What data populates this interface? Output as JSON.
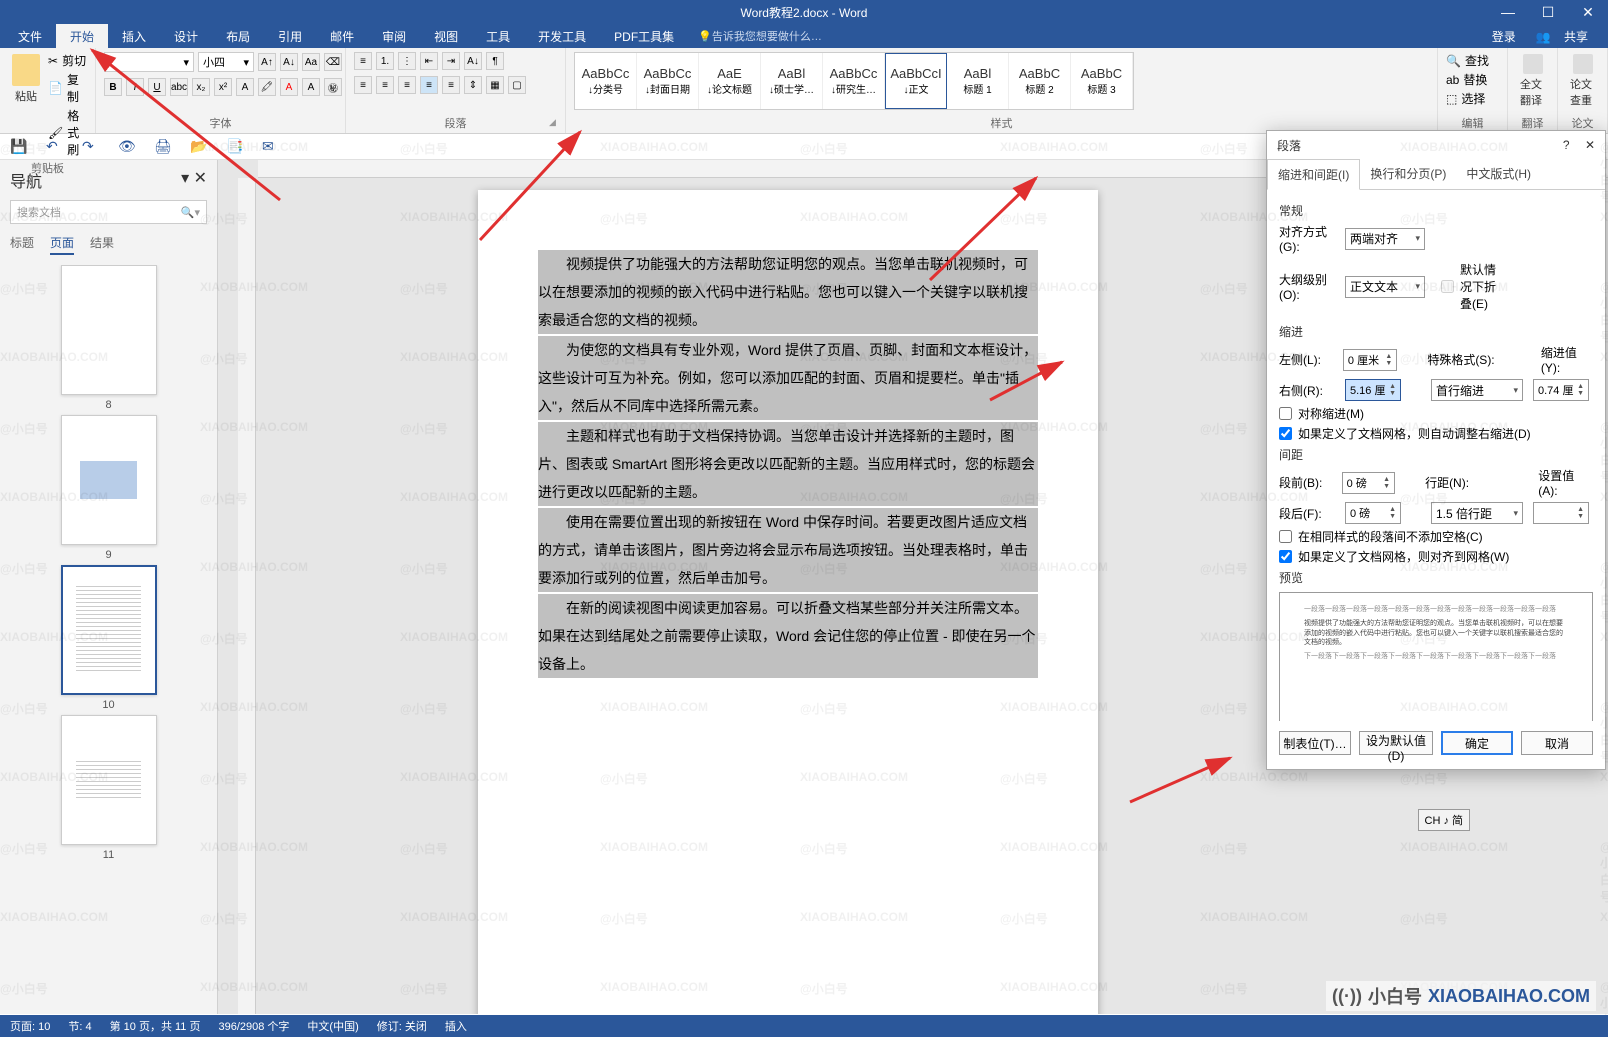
{
  "titlebar": {
    "doc_title": "Word教程2.docx - Word"
  },
  "menubar": {
    "tabs": [
      "文件",
      "开始",
      "插入",
      "设计",
      "布局",
      "引用",
      "邮件",
      "审阅",
      "视图",
      "工具",
      "开发工具",
      "PDF工具集"
    ],
    "active_index": 1,
    "tellme": "告诉我您想要做什么…",
    "signin": "登录",
    "share": "共享"
  },
  "ribbon": {
    "clipboard": {
      "paste": "粘贴",
      "cut": "剪切",
      "copy": "复制",
      "format_painter": "格式刷",
      "group": "剪贴板"
    },
    "font": {
      "size": "小四",
      "group": "字体"
    },
    "paragraph": {
      "group": "段落"
    },
    "styles": {
      "items": [
        {
          "preview": "AaBbCc",
          "name": "↓分类号"
        },
        {
          "preview": "AaBbCc",
          "name": "↓封面日期"
        },
        {
          "preview": "AaE",
          "name": "↓论文标题"
        },
        {
          "preview": "AaBl",
          "name": "↓硕士学…"
        },
        {
          "preview": "AaBbCc",
          "name": "↓研究生…"
        },
        {
          "preview": "AaBbCcI",
          "name": "↓正文"
        },
        {
          "preview": "AaBl",
          "name": "标题 1"
        },
        {
          "preview": "AaBbC",
          "name": "标题 2"
        },
        {
          "preview": "AaBbC",
          "name": "标题 3"
        }
      ],
      "selected_index": 5,
      "group": "样式"
    },
    "editing": {
      "find": "查找",
      "replace": "替换",
      "select": "选择",
      "group": "编辑"
    },
    "translate": {
      "full": "全文翻译",
      "group": "翻译"
    },
    "check": {
      "label": "论文查重",
      "group": "论文"
    }
  },
  "nav": {
    "title": "导航",
    "search_placeholder": "搜索文档",
    "tabs": [
      "标题",
      "页面",
      "结果"
    ],
    "active_tab": 1,
    "page_labels": [
      "8",
      "9",
      "10",
      "11"
    ],
    "selected_thumb": 2
  },
  "document": {
    "paragraphs": [
      "视频提供了功能强大的方法帮助您证明您的观点。当您单击联机视频时，可以在想要添加的视频的嵌入代码中进行粘贴。您也可以键入一个关键字以联机搜索最适合您的文档的视频。",
      "为使您的文档具有专业外观，Word 提供了页眉、页脚、封面和文本框设计，这些设计可互为补充。例如，您可以添加匹配的封面、页眉和提要栏。单击\"插入\"，然后从不同库中选择所需元素。",
      "主题和样式也有助于文档保持协调。当您单击设计并选择新的主题时，图片、图表或 SmartArt 图形将会更改以匹配新的主题。当应用样式时，您的标题会进行更改以匹配新的主题。",
      "使用在需要位置出现的新按钮在 Word 中保存时间。若要更改图片适应文档的方式，请单击该图片，图片旁边将会显示布局选项按钮。当处理表格时，单击要添加行或列的位置，然后单击加号。",
      "在新的阅读视图中阅读更加容易。可以折叠文档某些部分并关注所需文本。如果在达到结尾处之前需要停止读取，Word 会记住您的停止位置 - 即使在另一个设备上。"
    ]
  },
  "dialog": {
    "title": "段落",
    "help": "?",
    "close": "✕",
    "tabs": [
      "缩进和间距(I)",
      "换行和分页(P)",
      "中文版式(H)"
    ],
    "active_tab": 0,
    "general": "常规",
    "align_label": "对齐方式(G):",
    "align_value": "两端对齐",
    "outline_label": "大纲级别(O):",
    "outline_value": "正文文本",
    "collapse_label": "默认情况下折叠(E)",
    "indent": "缩进",
    "left_label": "左侧(L):",
    "left_value": "0 厘米",
    "right_label": "右侧(R):",
    "right_value": "5.16 厘",
    "special_label": "特殊格式(S):",
    "special_value": "首行缩进",
    "by_label": "缩进值(Y):",
    "by_value": "0.74 厘",
    "sym_label": "对称缩进(M)",
    "auto_right_label": "如果定义了文档网格，则自动调整右缩进(D)",
    "spacing": "间距",
    "before_label": "段前(B):",
    "before_value": "0 磅",
    "after_label": "段后(F):",
    "after_value": "0 磅",
    "line_label": "行距(N):",
    "line_value": "1.5 倍行距",
    "at_label": "设置值(A):",
    "at_value": "",
    "nospace_label": "在相同样式的段落间不添加空格(C)",
    "snap_label": "如果定义了文档网格，则对齐到网格(W)",
    "preview": "预览",
    "preview_sample": "视频提供了功能强大的方法帮助您证明您的观点。当您单击联机视频时，可以在想要添加的视频的嵌入代码中进行粘贴。您也可以键入一个关键字以联机搜索最适合您的文档的视频。",
    "tabs_btn": "制表位(T)…",
    "default_btn": "设为默认值(D)",
    "ok": "确定",
    "cancel": "取消"
  },
  "statusbar": {
    "page": "页面: 10",
    "section": "节: 4",
    "page_of": "第 10 页，共 11 页",
    "words": "396/2908 个字",
    "lang": "中文(中国)",
    "track": "修订: 关闭",
    "mode": "插入"
  },
  "ime": "CH ♪ 简",
  "watermark": {
    "brand": "小白号",
    "domain": "XIAOBAIHAO.COM"
  }
}
